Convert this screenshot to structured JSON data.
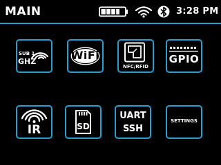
{
  "header": {
    "title": "MAIN",
    "time": "3:28 PM",
    "battery_level": 0.8,
    "status_icons": [
      "battery-icon",
      "wifi-icon",
      "bluetooth-icon"
    ]
  },
  "colors": {
    "accent": "#2a9fd6",
    "background": "#000000",
    "foreground": "#ffffff"
  },
  "menu": {
    "row1": [
      {
        "icon": "sub-ghz-icon",
        "top_text": "SUB 1",
        "label": "GHZ"
      },
      {
        "icon": "wifi-logo-icon",
        "label": "WiFi"
      },
      {
        "icon": "nfc-rfid-icon",
        "label": "NFC/RFID"
      },
      {
        "icon": "gpio-icon",
        "label": "GPIO"
      }
    ],
    "row2": [
      {
        "icon": "ir-icon",
        "label": "IR"
      },
      {
        "icon": "sd-card-icon",
        "label": "SD"
      },
      {
        "icon": "terminal-icon",
        "label": "UART",
        "label2": "SSH"
      },
      {
        "icon": "settings-icon",
        "label": "SETTINGS"
      }
    ]
  }
}
